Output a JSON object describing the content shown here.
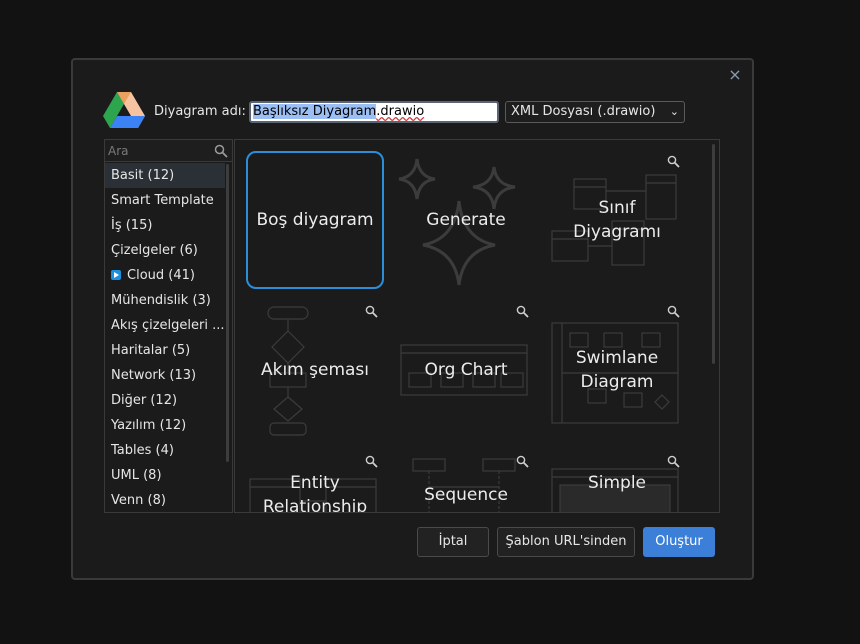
{
  "dialog": {
    "close_label": "×",
    "name_label": "Diyagram adı:",
    "filename_base": "Başlıksız Diyagram",
    "filename_ext": ".drawio",
    "format_selected": "XML Dosyası (.drawio)",
    "search_placeholder": "Ara",
    "categories": [
      {
        "label": "Basit (12)"
      },
      {
        "label": "Smart Template"
      },
      {
        "label": "İş (15)"
      },
      {
        "label": "Çizelgeler (6)"
      },
      {
        "label": "Cloud (41)"
      },
      {
        "label": "Mühendislik (3)"
      },
      {
        "label": "Akış çizelgeleri ..."
      },
      {
        "label": "Haritalar (5)"
      },
      {
        "label": "Network (13)"
      },
      {
        "label": "Diğer (12)"
      },
      {
        "label": "Yazılım (12)"
      },
      {
        "label": "Tables (4)"
      },
      {
        "label": "UML (8)"
      },
      {
        "label": "Venn (8)"
      }
    ],
    "templates": [
      {
        "label": "Boş diyagram"
      },
      {
        "label": "Generate"
      },
      {
        "label": "Sınıf Diyagramı"
      },
      {
        "label": "Akım şeması"
      },
      {
        "label": "Org Chart"
      },
      {
        "label": "Swimlane Diagram"
      },
      {
        "label": "Entity Relationship"
      },
      {
        "label": "Sequence"
      },
      {
        "label": "Simple"
      }
    ],
    "buttons": {
      "cancel": "İptal",
      "from_url": "Şablon URL'sinden",
      "create": "Oluştur"
    }
  }
}
